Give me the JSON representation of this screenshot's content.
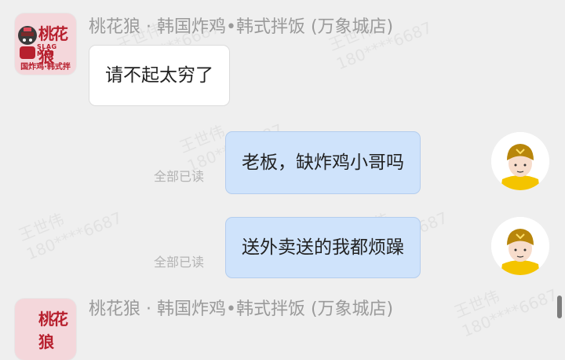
{
  "chat": {
    "shop_name": "桃花狼 · 韩国炸鸡•韩式拌饭 (万象城店)",
    "shop_logo_text": "桃花狼",
    "shop_logo_en": "SLAG MAN",
    "shop_logo_sub": "国炸鸡·韩式拌",
    "messages": [
      {
        "side": "left",
        "text": "请不起太穷了"
      },
      {
        "side": "right",
        "text": "老板，缺炸鸡小哥吗",
        "status": "全部已读"
      },
      {
        "side": "right",
        "text": "送外卖送的我都烦躁",
        "status": "全部已读"
      }
    ]
  },
  "watermark": {
    "name": "王世伟",
    "phone": "180****6687"
  },
  "colors": {
    "background": "#efefef",
    "self_bubble": "#cfe3fb",
    "other_bubble": "#ffffff",
    "brand": "#b7202e",
    "rider_helmet": "#b8860b"
  }
}
